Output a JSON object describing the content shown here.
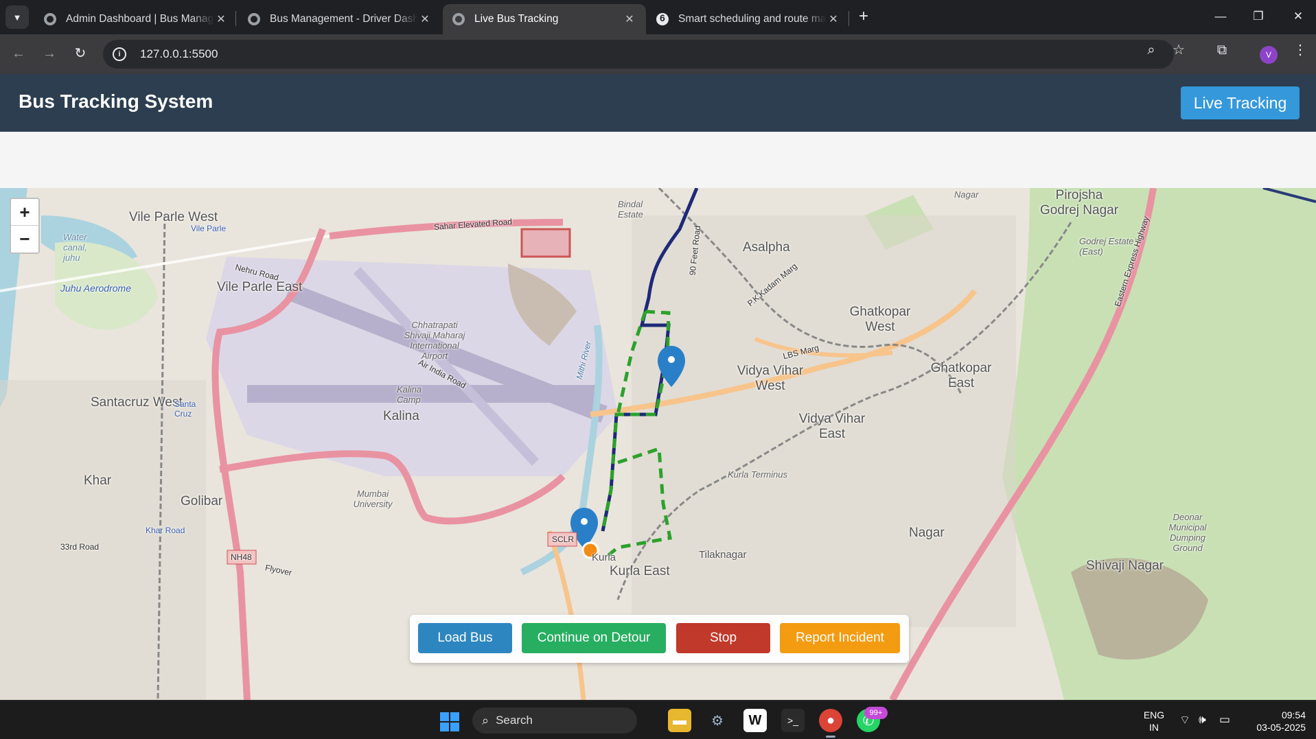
{
  "browser": {
    "tabs": [
      {
        "title": "Admin Dashboard | Bus Management"
      },
      {
        "title": "Bus Management - Driver Dashboard"
      },
      {
        "title": "Live Bus Tracking"
      },
      {
        "title": "Smart scheduling and route management"
      }
    ],
    "url": "127.0.0.1:5500"
  },
  "app": {
    "title": "Bus Tracking System",
    "live_tracking_label": "Live Tracking"
  },
  "map": {
    "zoom_in": "+",
    "zoom_out": "−",
    "labels": {
      "vile_parle_west": "Vile Parle West",
      "vile_parle_east": "Vile Parle East",
      "juhu_aerodrome": "Juhu Aerodrome",
      "water_canal": "Water canal, juhu",
      "santacruz_west": "Santacruz West",
      "khar": "Khar",
      "golibar": "Golibar",
      "kalina": "Kalina",
      "kalina_camp": "Kalina Camp",
      "airport": "Chhatrapati Shivaji Maharaj International Airport",
      "bindal_estate": "Bindal Estate",
      "asalpha": "Asalpha",
      "ghatkopar_west": "Ghatkopar West",
      "ghatkopar_east": "Ghatkopar East",
      "vidya_vihar_west": "Vidya Vihar West",
      "vidya_vihar_east": "Vidya Vihar East",
      "pirojsha": "Pirojsha Godrej Nagar",
      "godrej_estate": "Godrej Estate (East)",
      "kurla_terminus": "Kurla Terminus",
      "mumbai_university": "Mumbai University",
      "tilaknagar": "Tilaknagar",
      "kurla": "Kurla",
      "kurla_east": "Kurla East",
      "shivaji_nagar": "Shivaji Nagar",
      "deonar": "Deonar Municipal Dumping Ground",
      "nagar": "Nagar",
      "nagar_top": "Nagar",
      "sahar_road": "Sahar Elevated Road",
      "nehru_road": "Nehru Road",
      "sclr": "SCLR",
      "nh48": "NH48",
      "lbs_marg": "LBS Marg",
      "flyover": "Flyover",
      "khar_road": "Khar Road",
      "santa_cruz": "Santa Cruz",
      "vile_parle_station": "Vile Parle",
      "road_33rd": "33rd Road",
      "eastern_express": "Eastern Express Highway",
      "air_india_road": "Air India Road",
      "mithi_river": "Mithi River",
      "feet_road": "90 Feet Road",
      "kadam_marg": "P.K Kadam Marg"
    }
  },
  "controls": {
    "load_bus": "Load Bus",
    "continue_detour": "Continue on Detour",
    "stop": "Stop",
    "report_incident": "Report Incident"
  },
  "taskbar": {
    "search_placeholder": "Search",
    "whatsapp_badge": "99+",
    "lang_line1": "ENG",
    "lang_line2": "IN",
    "time": "09:54",
    "date": "03-05-2025"
  }
}
